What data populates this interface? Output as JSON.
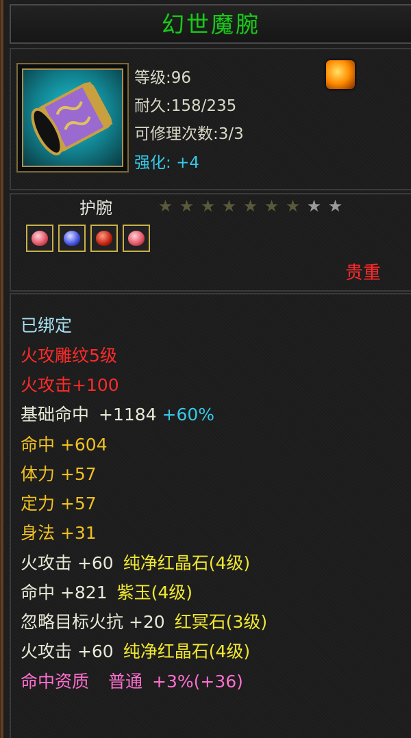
{
  "title": "幻世魔腕",
  "stats": {
    "level": "等级:96",
    "durability": "耐久:158/235",
    "repair": "可修理次数:3/3",
    "enhance_label": "强化:",
    "enhance_value": "+4"
  },
  "item_type": "护腕",
  "stars": {
    "filled": 7,
    "total": 9
  },
  "gems": [
    {
      "icon": "pink-crystal-gem",
      "color": "#e05060"
    },
    {
      "icon": "blue-jade-gem",
      "color": "#4050e0"
    },
    {
      "icon": "red-crystal-gem",
      "color": "#c02010"
    },
    {
      "icon": "pink-crystal-gem",
      "color": "#e05060"
    }
  ],
  "rarity": "贵重",
  "attributes": {
    "bound": "已绑定",
    "engrave": "火攻雕纹5级",
    "fire_attack": "火攻击+100",
    "base_hit_label": "基础命中",
    "base_hit_value": "+1184",
    "base_hit_pct": "+60%",
    "hit": "命中 +604",
    "stamina": "体力 +57",
    "focus": "定力 +57",
    "agility": "身法 +31",
    "gem1_stat": "火攻击 +60",
    "gem1_name": "纯净红晶石(4级)",
    "gem2_stat": "命中 +821",
    "gem2_name": "紫玉(4级)",
    "gem3_stat": "忽略目标火抗 +20",
    "gem3_name": "红冥石(3级)",
    "gem4_stat": "火攻击 +60",
    "gem4_name": "纯净红晶石(4级)",
    "aptitude_label": "命中资质",
    "aptitude_grade": "普通",
    "aptitude_value": "+3%(+36)"
  }
}
